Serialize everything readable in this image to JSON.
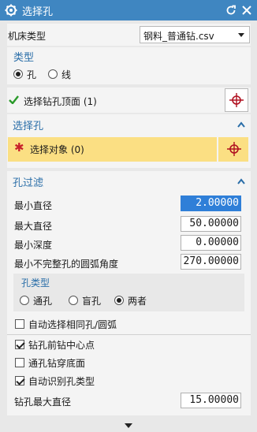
{
  "window": {
    "title": "选择孔",
    "reset_icon": "reset-icon",
    "close_icon": "close-icon"
  },
  "machine": {
    "label": "机床类型",
    "selected": "钢料_普通钻.csv"
  },
  "type_group": {
    "title": "类型",
    "options": [
      "孔",
      "线"
    ],
    "selected": "孔"
  },
  "face_select": {
    "label": "选择钻孔顶面 (1)",
    "status": "complete"
  },
  "select_hole": {
    "title": "选择孔",
    "object_label": "选择对象 (0)",
    "required_mark": "✱",
    "highlight_color": "#fbdf83"
  },
  "filter": {
    "title": "孔过滤",
    "fields": [
      {
        "label": "最小直径",
        "value": "2.00000"
      },
      {
        "label": "最大直径",
        "value": "50.00000"
      },
      {
        "label": "最小深度",
        "value": "0.00000"
      },
      {
        "label": "最小不完整孔的圆弧角度",
        "value": "270.00000"
      }
    ],
    "hole_type": {
      "title": "孔类型",
      "options": [
        "通孔",
        "盲孔",
        "两者"
      ],
      "selected": "两者"
    },
    "checkboxes": [
      {
        "label": "自动选择相同孔/圆弧",
        "checked": false
      },
      {
        "label": "钻孔前钻中心点",
        "checked": true
      },
      {
        "label": "通孔钻穿底面",
        "checked": false
      },
      {
        "label": "自动识别孔类型",
        "checked": true
      }
    ],
    "max_drill": {
      "label": "钻孔最大直径",
      "value": "15.00000"
    }
  },
  "colors": {
    "title_bar": "#3f86c1",
    "section_title": "#2a6ea8",
    "crosshair": "#b01020",
    "check_green": "#2a9a2a"
  }
}
